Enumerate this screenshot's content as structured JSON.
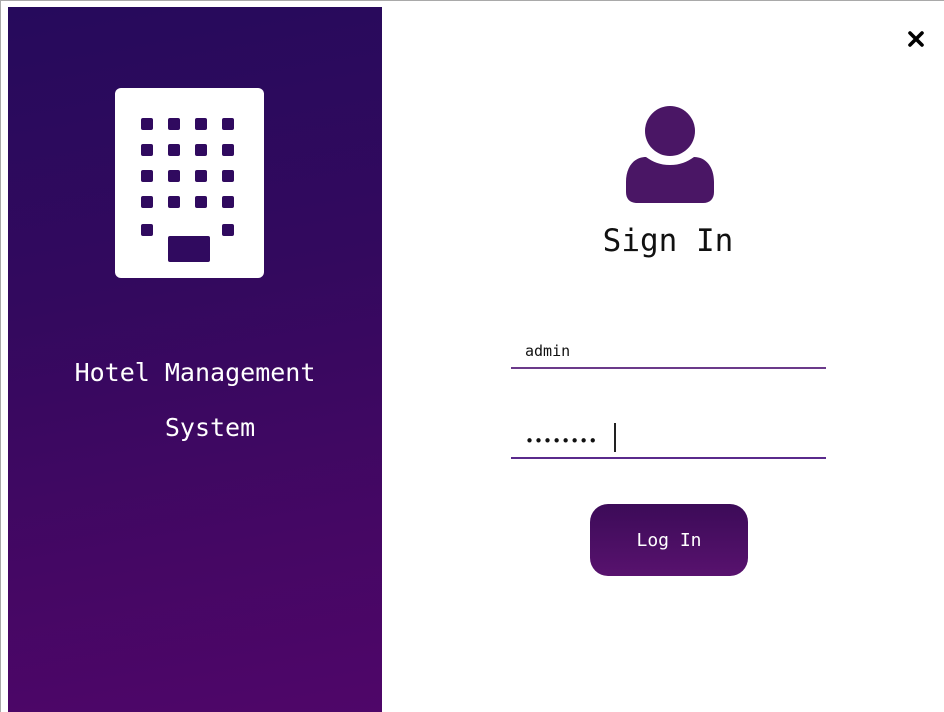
{
  "app": {
    "title_line1": "Hotel Management",
    "title_line2": "System",
    "logo_icon": "building-icon"
  },
  "window": {
    "close_icon": "close-icon"
  },
  "signin": {
    "user_icon": "user-icon",
    "title": "Sign In",
    "username_value": "admin",
    "password_value": "••••••••",
    "login_label": "Log In"
  },
  "colors": {
    "panel_gradient_start": "#260a5c",
    "panel_gradient_end": "#4f0669",
    "accent": "#4a1665",
    "button": "#4a0f63"
  }
}
